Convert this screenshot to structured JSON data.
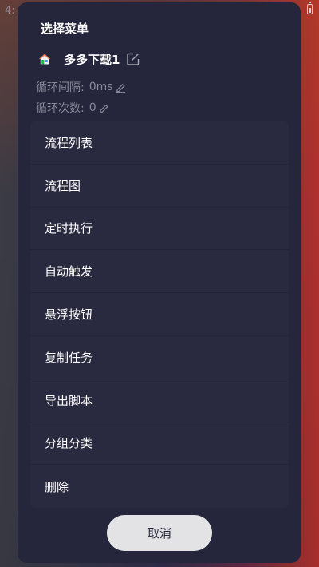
{
  "status_bar": {
    "time_partial": "4:"
  },
  "dialog": {
    "title": "选择菜单",
    "task_name": "多多下载1",
    "loop_interval_label": "循环间隔:",
    "loop_interval_value": "0ms",
    "loop_count_label": "循环次数:",
    "loop_count_value": "0",
    "menu_items": [
      {
        "label": "流程列表"
      },
      {
        "label": "流程图"
      },
      {
        "label": "定时执行"
      },
      {
        "label": "自动触发"
      },
      {
        "label": "悬浮按钮"
      },
      {
        "label": "复制任务"
      },
      {
        "label": "导出脚本"
      },
      {
        "label": "分组分类"
      },
      {
        "label": "删除"
      }
    ],
    "cancel_label": "取消"
  },
  "colors": {
    "dialog_bg": "#25253b",
    "menu_bg": "#29293f",
    "cancel_bg": "#e3e3e6",
    "muted_text": "#8a8a9a"
  }
}
